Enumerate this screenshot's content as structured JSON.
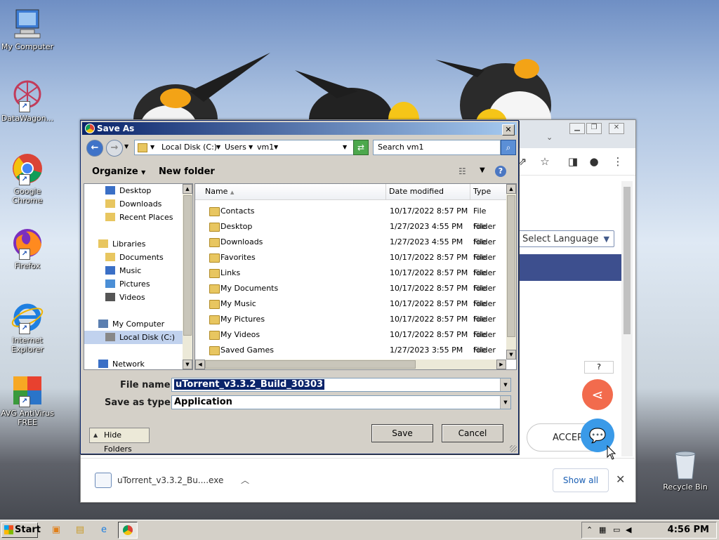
{
  "desktop": {
    "icons": [
      {
        "label": "My Computer"
      },
      {
        "label": "DataWagon..."
      },
      {
        "label": "Google Chrome"
      },
      {
        "label": "Firefox"
      },
      {
        "label": "Internet Explorer"
      },
      {
        "label": "AVG AntiVirus FREE"
      }
    ],
    "recycle_bin": "Recycle Bin"
  },
  "browser": {
    "language_select": "Select Language",
    "help_mark": "?",
    "accept_label": "ACCEPT",
    "download": {
      "filename": "uTorrent_v3.3.2_Bu....exe",
      "show_all": "Show all"
    }
  },
  "dialog": {
    "title": "Save As",
    "address": {
      "crumbs": [
        "Local Disk (C:)",
        "Users",
        "vm1"
      ]
    },
    "search_placeholder": "Search vm1",
    "toolbar": {
      "organize": "Organize",
      "new_folder": "New folder"
    },
    "nav": {
      "items": [
        {
          "label": "Desktop",
          "indent": 1
        },
        {
          "label": "Downloads",
          "indent": 1
        },
        {
          "label": "Recent Places",
          "indent": 1
        },
        {
          "label": "Libraries",
          "indent": 0
        },
        {
          "label": "Documents",
          "indent": 1
        },
        {
          "label": "Music",
          "indent": 1
        },
        {
          "label": "Pictures",
          "indent": 1
        },
        {
          "label": "Videos",
          "indent": 1
        },
        {
          "label": "My Computer",
          "indent": 0
        },
        {
          "label": "Local Disk (C:)",
          "indent": 1,
          "selected": true
        },
        {
          "label": "Network",
          "indent": 0
        }
      ]
    },
    "columns": {
      "name": "Name",
      "date": "Date modified",
      "type": "Type"
    },
    "files": [
      {
        "name": "Contacts",
        "date": "10/17/2022 8:57 PM",
        "type": "File folder"
      },
      {
        "name": "Desktop",
        "date": "1/27/2023 4:55 PM",
        "type": "File folder"
      },
      {
        "name": "Downloads",
        "date": "1/27/2023 4:55 PM",
        "type": "File folder"
      },
      {
        "name": "Favorites",
        "date": "10/17/2022 8:57 PM",
        "type": "File folder"
      },
      {
        "name": "Links",
        "date": "10/17/2022 8:57 PM",
        "type": "File folder"
      },
      {
        "name": "My Documents",
        "date": "10/17/2022 8:57 PM",
        "type": "File folder"
      },
      {
        "name": "My Music",
        "date": "10/17/2022 8:57 PM",
        "type": "File folder"
      },
      {
        "name": "My Pictures",
        "date": "10/17/2022 8:57 PM",
        "type": "File folder"
      },
      {
        "name": "My Videos",
        "date": "10/17/2022 8:57 PM",
        "type": "File folder"
      },
      {
        "name": "Saved Games",
        "date": "1/27/2023 3:55 PM",
        "type": "File folder"
      }
    ],
    "file_name_label": "File name:",
    "file_name_value": "uTorrent_v3.3.2_Build_30303",
    "save_type_label": "Save as type:",
    "save_type_value": "Application",
    "hide_folders": "Hide Folders",
    "save": "Save",
    "cancel": "Cancel"
  },
  "taskbar": {
    "start": "Start",
    "clock": "4:56 PM"
  }
}
